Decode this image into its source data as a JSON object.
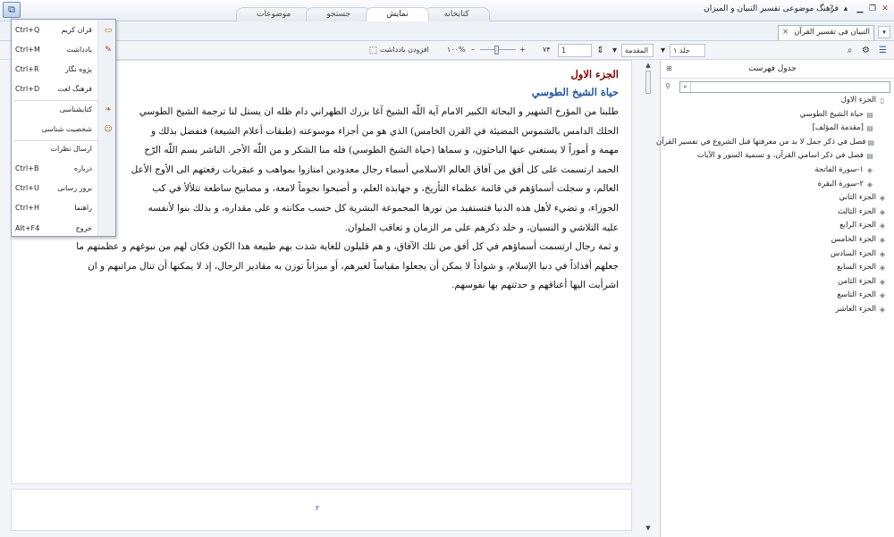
{
  "window": {
    "title": "فرهنگ موضوعی تفسیر التبیان و المیزان",
    "app_button_icon": "logo-icon",
    "controls": [
      "?",
      "_",
      "▭",
      "✕"
    ]
  },
  "ribbon_tabs": [
    {
      "label": "موضوعات"
    },
    {
      "label": "جستجو"
    },
    {
      "label": "نمایش",
      "active": true
    },
    {
      "label": "کتابخانه"
    }
  ],
  "doc_tab": {
    "label": "التبیان فی تفسیر القرآن",
    "close": "×"
  },
  "toolbar": {
    "add_note": "افزودن یادداشت",
    "zoom_percent": "۱۰۰%",
    "zoom_minus": "–",
    "zoom_plus": "+",
    "page_total": "۷۴",
    "page_current": "1",
    "section_value": "المقدمة",
    "volume_value": "جلد ۱"
  },
  "content": {
    "chapter_title": "الجزء الاول",
    "section_title": "حياة الشيخ الطوسي",
    "lines": [
      "طلبنا من المؤرخ الشهير و البحاثة الكبير الامام آية اللّه الشيخ آغا بزرك الطهراني دام ظله ان يستل لنا ترجمة الشيخ الطوسي",
      "الحلك الدامس بالشموس المضيئة في القرن الخامس) الذي هو من أجزاء موسوعته (طبقات أعلام الشيعة) فتفضل بذلك و",
      "مهمة و أموراً لا يستغني عنها الباحثون، و سماها (حياة الشيخ الطوسي) فله منا الشكر و من اللّه الأجر. الناشر بسم اللّه الرّح",
      "الحمد ارتسمت على كل أفق من آفاق العالم الاسلامي أسماء رجال معدودين امتازوا بمواهب و عبقريات رفعتهم الى الأوج الأعل",
      "العالم، و سجلت أسماؤهم في قائمة عظماء التأريخ، و جهابذة العلم، و أصبحوا نجوماً لامعة، و مصابيح ساطعة تتلألأ في كب",
      "الجوزاء، و تضيء لأهل هذه الدنيا فتستفيد من نورها المجموعة البشرية كل حسب مكانته و على مقداره، و بذلك بنوا لأنفسه",
      "عليه التلاشي و النسيان، و خلد ذكرهم على مر الزمان و تعاقب الملوان.",
      "و ثمة رجال ارتسمت أسماؤهم في كل أفق من تلك الآفاق، و هم قليلون للغاية شذت بهم طبيعة هذا الكون فكان لهم من نبوغهم و عظمتهم ما",
      "جعلهم أفذاذاً في دنيا الإسلام، و شواذاً لا يمكن أن يجعلوا مقياساً لغيرهم، أو ميزاناً توزن به مقادير الرجال، إذ لا يمكنها أن تنال مراتبهم و ان",
      "اشرأبت اليها أعناقهم و حدثتهم بها نفوسهم."
    ],
    "page_number": "۲"
  },
  "toc": {
    "title": "جدول فهرست",
    "items": [
      {
        "label": "الجزء الاول",
        "icon": "book-open-icon",
        "level": 1
      },
      {
        "label": "حياة الشيخ الطوسي",
        "icon": "page-icon",
        "level": 2
      },
      {
        "label": "[مقدمة المؤلف]",
        "icon": "page-icon",
        "level": 2
      },
      {
        "label": "فصل في ذكر جمل لا بد من معرفتها قبل الشروع في تفسير القرآن",
        "icon": "page-icon",
        "level": 2
      },
      {
        "label": "فصل في ذكر اسامي القرآن، و تسمية السور و الآيات",
        "icon": "page-icon",
        "level": 2
      },
      {
        "label": "١-سورة الفاتحة",
        "icon": "book-closed-icon",
        "level": 2
      },
      {
        "label": "٢-سورة البقرة",
        "icon": "book-closed-icon",
        "level": 2
      },
      {
        "label": "الجزء الثاني",
        "icon": "book-closed-icon",
        "level": 1
      },
      {
        "label": "الجزء الثالث",
        "icon": "book-closed-icon",
        "level": 1
      },
      {
        "label": "الجزء الرابع",
        "icon": "book-closed-icon",
        "level": 1
      },
      {
        "label": "الجزء الخامس",
        "icon": "book-closed-icon",
        "level": 1
      },
      {
        "label": "الجزء السادس",
        "icon": "book-closed-icon",
        "level": 1
      },
      {
        "label": "الجزء السابع",
        "icon": "book-closed-icon",
        "level": 1
      },
      {
        "label": "الجزء الثامن",
        "icon": "book-closed-icon",
        "level": 1
      },
      {
        "label": "الجزء التاسع",
        "icon": "book-closed-icon",
        "level": 1
      },
      {
        "label": "الجزء العاشر",
        "icon": "book-closed-icon",
        "level": 1
      }
    ]
  },
  "app_menu": {
    "items": [
      {
        "label": "قران کریم",
        "shortcut": "Ctrl+Q",
        "icon": "quran-icon"
      },
      {
        "label": "یادداشت",
        "shortcut": "Ctrl+M",
        "icon": "note-icon"
      },
      {
        "label": "پژوه نگار",
        "shortcut": "Ctrl+R",
        "icon": ""
      },
      {
        "label": "فرهنگ لغت",
        "shortcut": "Ctrl+D",
        "icon": ""
      },
      {
        "label": "کتابشناسی",
        "shortcut": "",
        "icon": "books-icon"
      },
      {
        "label": "شخصیت شناسی",
        "shortcut": "",
        "icon": "person-icon"
      },
      {
        "label": "ارسال نظرات",
        "shortcut": "",
        "icon": ""
      },
      {
        "label": "درباره",
        "shortcut": "Ctrl+B",
        "icon": ""
      },
      {
        "label": "بروز رسانی",
        "shortcut": "Ctrl+U",
        "icon": ""
      },
      {
        "label": "راهنما",
        "shortcut": "Ctrl+H",
        "icon": ""
      },
      {
        "label": "خروج",
        "shortcut": "Alt+F4",
        "icon": ""
      }
    ]
  }
}
